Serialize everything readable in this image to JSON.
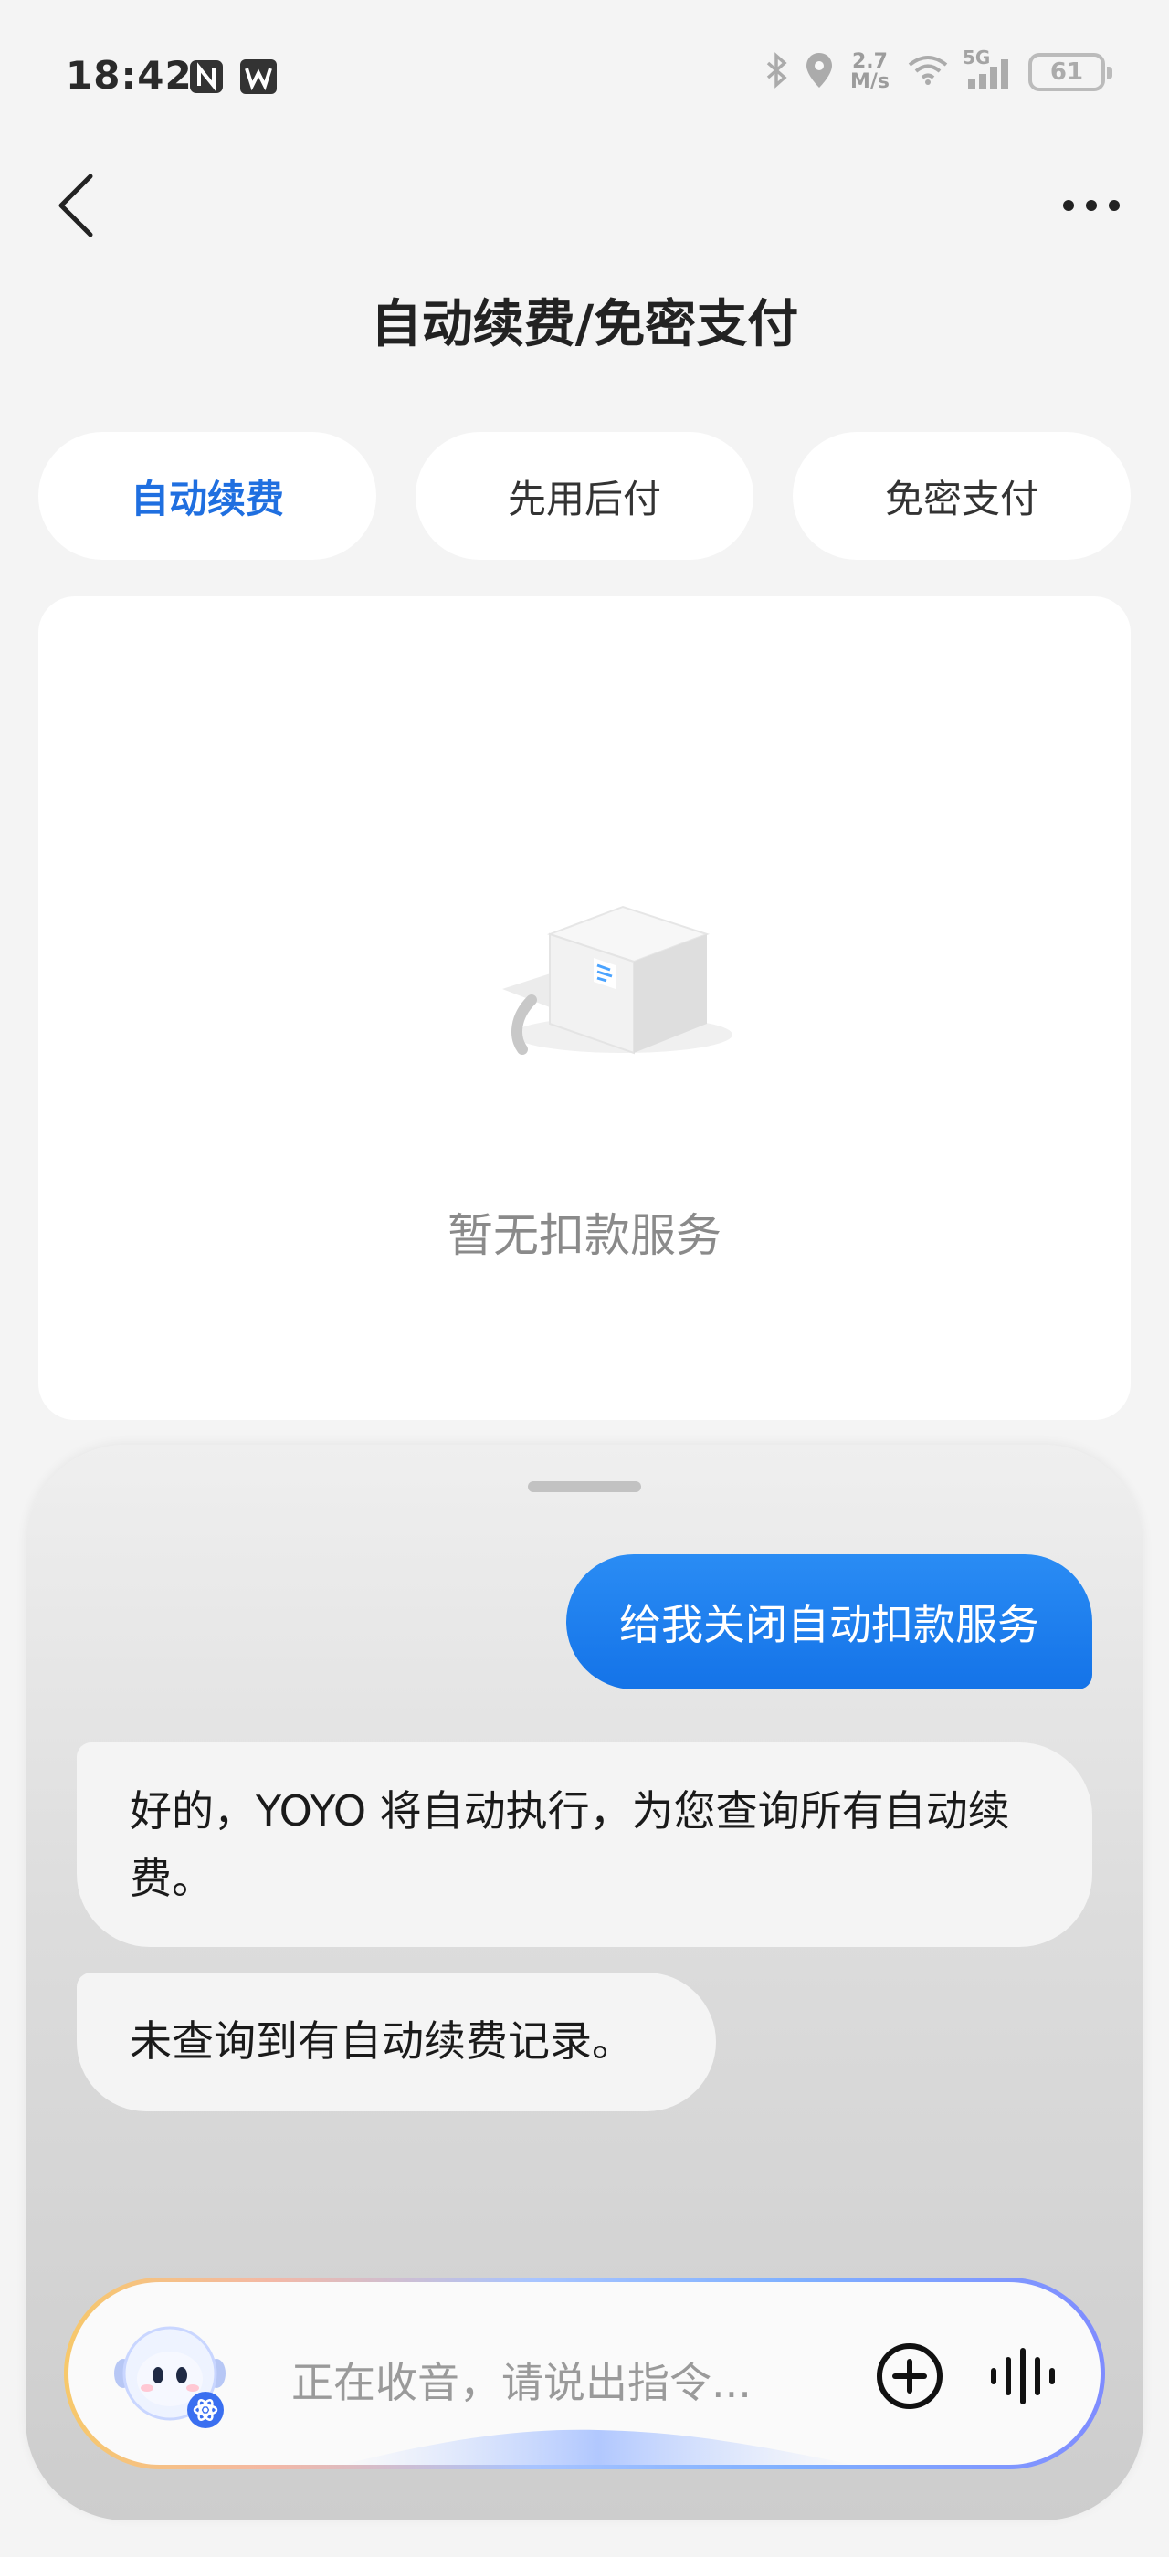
{
  "status_bar": {
    "time": "18:42",
    "net_speed_value": "2.7",
    "net_speed_unit": "M/s",
    "network_label": "5G",
    "battery_level": "61"
  },
  "header": {
    "title": "自动续费/免密支付"
  },
  "tabs": [
    {
      "label": "自动续费",
      "active": true
    },
    {
      "label": "先用后付",
      "active": false
    },
    {
      "label": "免密支付",
      "active": false
    }
  ],
  "content": {
    "empty_text": "暂无扣款服务"
  },
  "assistant": {
    "messages": [
      {
        "role": "user",
        "text": "给我关闭自动扣款服务"
      },
      {
        "role": "assistant",
        "text": "好的，YOYO 将自动执行，为您查询所有自动续费。"
      },
      {
        "role": "assistant",
        "text": "未查询到有自动续费记录。"
      }
    ],
    "input_placeholder": "正在收音，请说出指令..."
  },
  "colors": {
    "accent": "#1f6fe0",
    "user_bubble": "#1473e8",
    "background": "#f4f4f4"
  },
  "icons": [
    "nfc-icon",
    "wps-icon",
    "bluetooth-icon",
    "location-icon",
    "wifi-icon",
    "signal-icon",
    "battery-icon",
    "back-icon",
    "more-icon",
    "empty-box-icon",
    "yoyo-avatar-icon",
    "add-icon",
    "voice-wave-icon"
  ]
}
